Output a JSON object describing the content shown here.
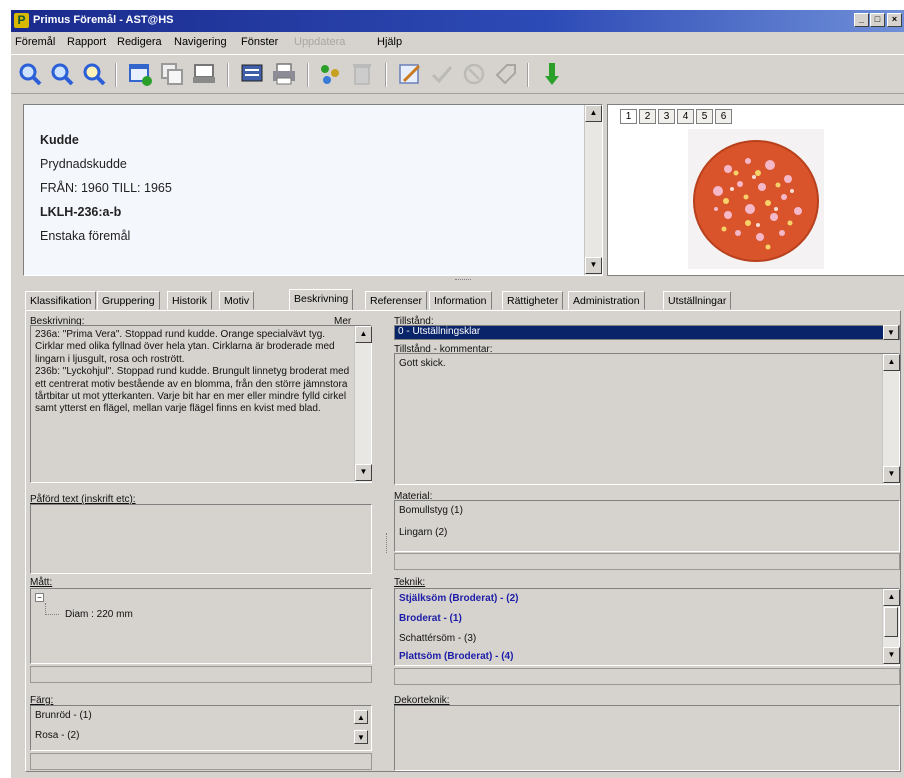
{
  "window": {
    "title": "Primus Föremål - AST@HS",
    "app_logo": "P",
    "controls": [
      "_",
      "□",
      "×"
    ]
  },
  "menu": {
    "items": [
      "Föremål",
      "Rapport",
      "Redigera",
      "Navigering",
      "Fönster",
      "Uppdatera",
      "Hjälp"
    ]
  },
  "toolbar": {
    "icons": [
      "search-icon",
      "search-next-icon",
      "search-all-icon",
      "new-record-icon",
      "copy-record-icon",
      "print-preview-icon",
      "report-icon",
      "print-icon",
      "structure-icon",
      "delete-icon",
      "edit-icon",
      "check-icon",
      "cancel-icon",
      "tag-icon",
      "arrow-down-icon"
    ]
  },
  "summary": {
    "name": "Kudde",
    "subname": "Prydnadskudde",
    "date": "FRÅN: 1960 TILL: 1965",
    "id": "LKLH-236:a-b",
    "type": "Enstaka föremål"
  },
  "images": {
    "tabs": [
      "1",
      "2",
      "3",
      "4",
      "5",
      "6"
    ]
  },
  "tabs": [
    "Klassifikation",
    "Gruppering",
    "Historik",
    "Motiv",
    "Beskrivning",
    "Referenser",
    "Information",
    "Rättigheter",
    "Administration",
    "Utställningar"
  ],
  "active_tab": "Beskrivning",
  "beskrivning": {
    "label": "Beskrivning:",
    "more": "Mer",
    "text": "236a: \"Prima Vera\". Stoppad rund kudde. Orange specialvävt tyg. Cirklar med olika fyllnad över hela ytan. Cirklarna är broderade med lingarn i ljusgult, rosa och rostrött.\n236b: \"Lyckohjul\". Stoppad rund kudde. Brungult linnetyg broderat med ett centrerat motiv bestående av en blomma, från den större jämnstora tårtbitar ut mot ytterkanten. Varje bit har en mer eller mindre fylld cirkel samt ytterst en flägel, mellan varje flägel finns en kvist med blad."
  },
  "paford": {
    "label": "Påförd text (inskrift etc):"
  },
  "matt": {
    "label": "Mått:",
    "node": "Diam : 220 mm"
  },
  "farg": {
    "label": "Färg:",
    "items": [
      "Brunröd - (1)",
      "Rosa - (2)"
    ]
  },
  "tillstand": {
    "label": "Tillstånd:",
    "value": "0 - Utställningsklar"
  },
  "tillstand_kommentar": {
    "label": "Tillstånd - kommentar:",
    "value": "Gott skick."
  },
  "material": {
    "label": "Material:",
    "items": [
      "Bomullstyg (1)",
      "Lingarn (2)"
    ]
  },
  "teknik": {
    "label": "Teknik:",
    "items": [
      {
        "text": "Stjälksöm (Broderat) - (2)",
        "bold": true
      },
      {
        "text": "Broderat - (1)",
        "bold": true
      },
      {
        "text": "Schattérsöm - (3)",
        "bold": false
      },
      {
        "text": "Plattsöm (Broderat) - (4)",
        "bold": true
      }
    ]
  },
  "dekorteknik": {
    "label": "Dekorteknik:"
  },
  "colors": {
    "title_start": "#1a2a8c",
    "selected": "#0a246a",
    "cushion": "#d9542b"
  }
}
